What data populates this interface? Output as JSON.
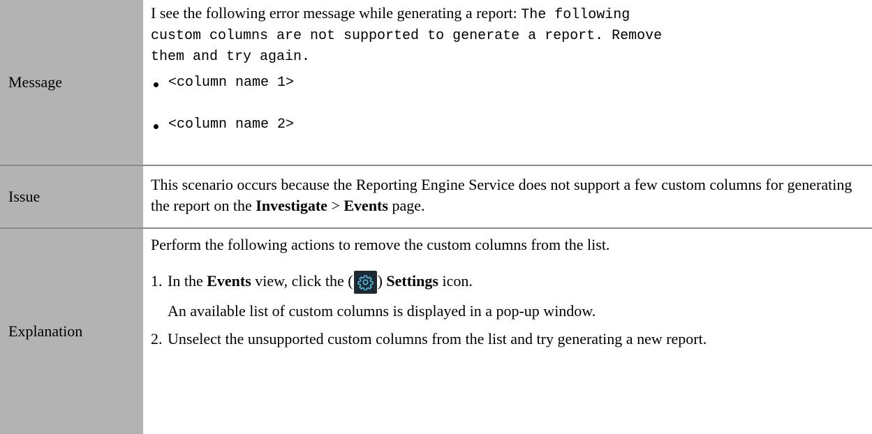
{
  "rows": {
    "message": {
      "label": "Message",
      "intro": "I see the following error message while generating a report:",
      "error_part1": "The following",
      "error_part2": "custom columns are not supported to generate a report. Remove",
      "error_part3": "them and try again.",
      "bullets": [
        "<column name 1>",
        "<column name 2>"
      ]
    },
    "issue": {
      "label": "Issue",
      "text_before": "This scenario occurs because the Reporting Engine Service does not support a few custom columns for generating the report on the",
      "bold1": "Investigate",
      "sep": " > ",
      "bold2": "Events",
      "text_after": " page."
    },
    "explanation": {
      "label": "Explanation",
      "intro": "Perform the following actions to remove the custom columns from the list.",
      "step1": {
        "num": "1.",
        "p1": "In the ",
        "bold1": "Events",
        "p2": " view, click the (",
        "p3": ") ",
        "bold2": "Settings",
        "p4": " icon.",
        "sub": "An available list of custom columns is displayed in a pop-up window.",
        "icon": "settings-gear-icon"
      },
      "step2": {
        "num": "2.",
        "text": "Unselect the unsupported custom columns from the list and try generating a new report."
      }
    }
  },
  "colors": {
    "label_bg": "#b3b3b3",
    "separator": "#8a8a8a",
    "icon_bg": "#1e2a33",
    "icon_fg": "#4fc3e8"
  }
}
